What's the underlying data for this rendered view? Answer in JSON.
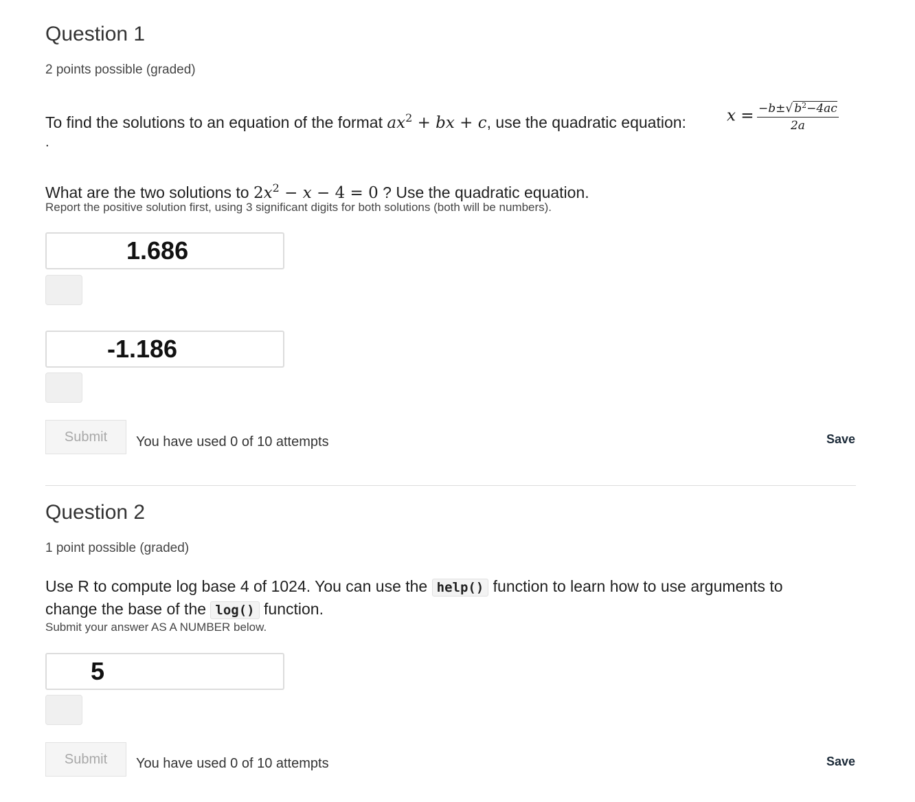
{
  "q1": {
    "title": "Question 1",
    "points": "2 points possible (graded)",
    "intro_text": "To find the solutions to an equation of the format ",
    "intro_math": "ax² + bx + c",
    "intro_text2": ", use the quadratic equation: ",
    "formula_lhs": "x =",
    "formula_num": "−b±√(b²−4ac)",
    "formula_den": "2a",
    "trailing_dot": ".",
    "question_prefix": "What are the two solutions to ",
    "question_math": "2x² − x − 4 = 0",
    "question_suffix": " ? Use the quadratic equation.",
    "hint": "Report the positive solution first, using 3 significant digits for both solutions (both will be numbers).",
    "answer1_value": "1.686",
    "answer2_value": "-1.186",
    "submit_label": "Submit",
    "attempts": "You have used 0 of 10 attempts",
    "save_label": "Save"
  },
  "q2": {
    "title": "Question 2",
    "points": "1 point possible (graded)",
    "prompt_part1": "Use R to compute log base 4 of 1024. You can use the ",
    "code1": "help()",
    "prompt_part2": " function to learn how to use arguments to change the base of the ",
    "code2": "log()",
    "prompt_part3": " function.",
    "hint": "Submit your answer AS A NUMBER below.",
    "answer_value": "5",
    "submit_label": "Submit",
    "attempts": "You have used 0 of 10 attempts",
    "save_label": "Save"
  }
}
